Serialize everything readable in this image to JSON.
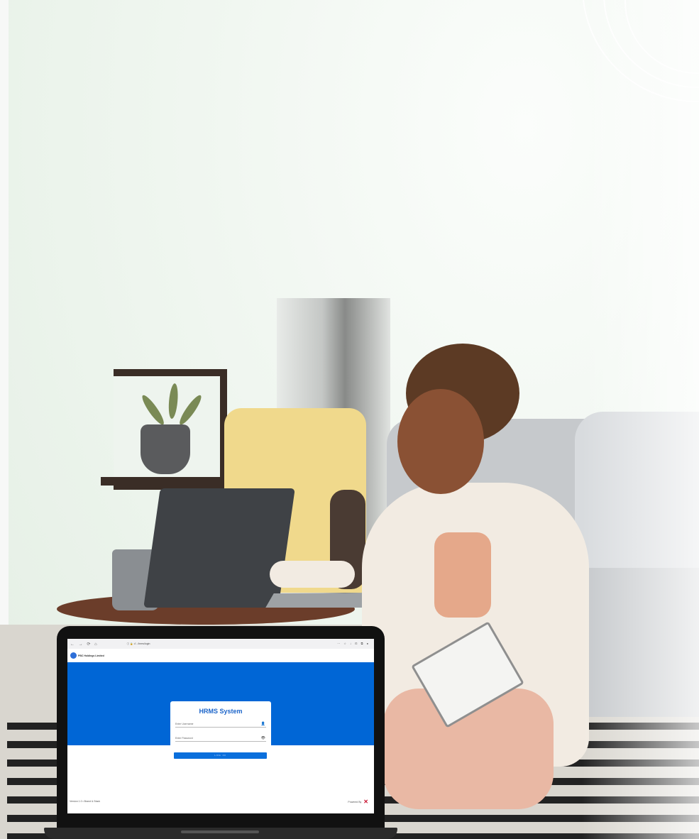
{
  "browser": {
    "nav_icons": "← → ⟳ ⌂",
    "url": "ⓘ 🔒 ://.../hrms/login",
    "toolbar_icons": "⋯ ☆ ↓ ⊡ ⧉ ●"
  },
  "site": {
    "company_name": "PBC Holdings Limited"
  },
  "login": {
    "title": "HRMS System",
    "username_placeholder": "Enter Username",
    "password_placeholder": "Enter Password",
    "submit_label": "LOG IN"
  },
  "footer": {
    "left_text": "Version 1.0 • Brand & Stack",
    "right_text": "Powered By"
  },
  "colors": {
    "brand_blue": "#0066d6",
    "button_blue": "#0a6fdc",
    "title_blue": "#1b64c9"
  }
}
